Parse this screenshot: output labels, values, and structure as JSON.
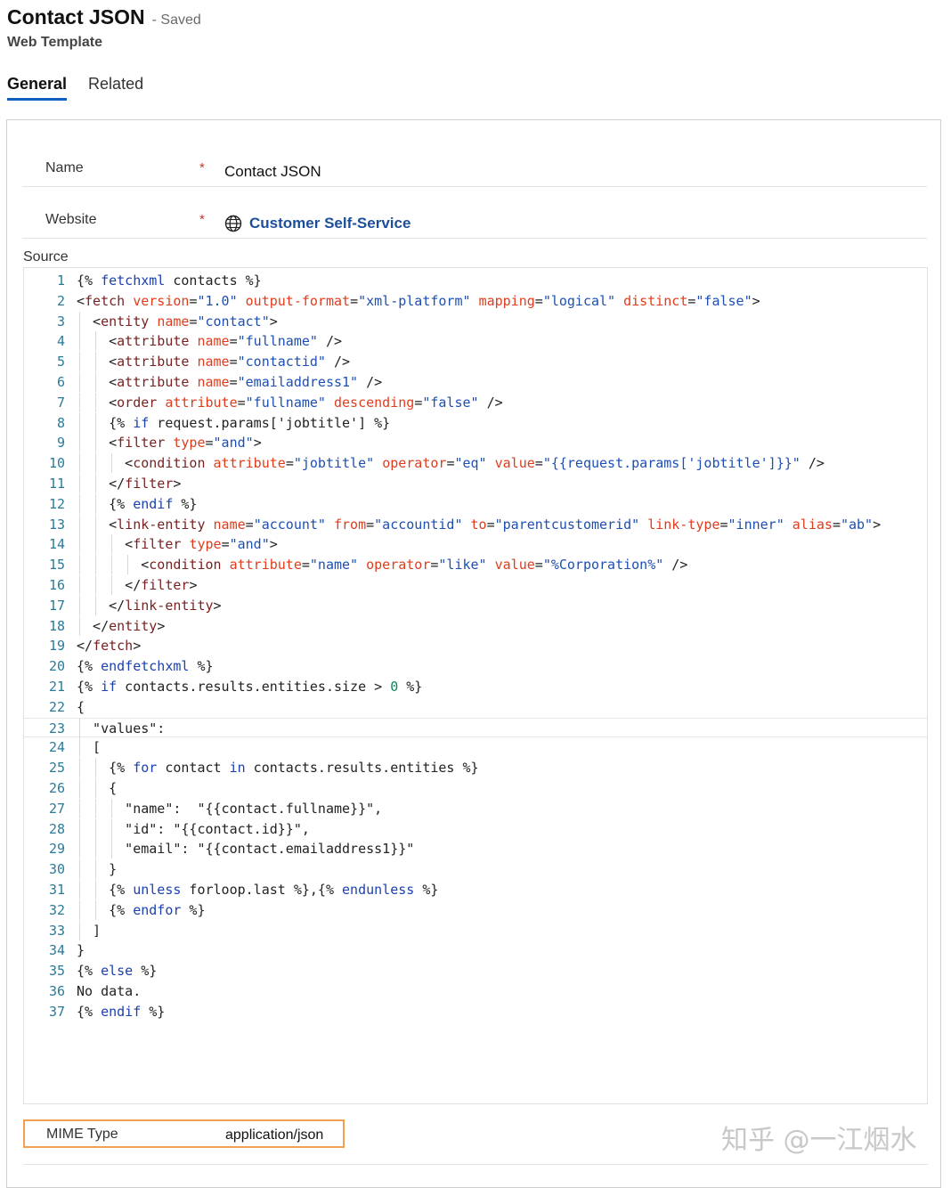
{
  "header": {
    "title": "Contact JSON",
    "status": "- Saved",
    "subtitle": "Web Template"
  },
  "tabs": [
    {
      "label": "General",
      "active": true
    },
    {
      "label": "Related",
      "active": false
    }
  ],
  "fields": {
    "name": {
      "label": "Name",
      "required": "*",
      "value": "Contact JSON"
    },
    "website": {
      "label": "Website",
      "required": "*",
      "value": "Customer Self-Service",
      "icon": "globe-icon"
    },
    "source": {
      "label": "Source"
    },
    "mime": {
      "label": "MIME Type",
      "value": "application/json"
    }
  },
  "code_lines": [
    "{% fetchxml contacts %}",
    "<fetch version=\"1.0\" output-format=\"xml-platform\" mapping=\"logical\" distinct=\"false\">",
    "  <entity name=\"contact\">",
    "    <attribute name=\"fullname\" />",
    "    <attribute name=\"contactid\" />",
    "    <attribute name=\"emailaddress1\" />",
    "    <order attribute=\"fullname\" descending=\"false\" />",
    "    {% if request.params['jobtitle'] %}",
    "    <filter type=\"and\">",
    "      <condition attribute=\"jobtitle\" operator=\"eq\" value=\"{{request.params['jobtitle']}}\" />",
    "    </filter>",
    "    {% endif %}",
    "    <link-entity name=\"account\" from=\"accountid\" to=\"parentcustomerid\" link-type=\"inner\" alias=\"ab\">",
    "      <filter type=\"and\">",
    "        <condition attribute=\"name\" operator=\"like\" value=\"%Corporation%\" />",
    "      </filter>",
    "    </link-entity>",
    "  </entity>",
    "</fetch>",
    "{% endfetchxml %}",
    "{% if contacts.results.entities.size > 0 %}",
    "{",
    "  \"values\":",
    "  [",
    "    {% for contact in contacts.results.entities %}",
    "    {",
    "      \"name\":  \"{{contact.fullname}}\",",
    "      \"id\": \"{{contact.id}}\",",
    "      \"email\": \"{{contact.emailaddress1}}\"",
    "    }",
    "    {% unless forloop.last %},{% endunless %}",
    "    {% endfor %}",
    "  ]",
    "}",
    "{% else %}",
    "No data.",
    "{% endif %}"
  ],
  "watermark": "知乎 @一江烟水",
  "colors": {
    "accent": "#1060c0",
    "link": "#1b4f9c",
    "required": "#c0392b",
    "highlight_border": "#f0a050"
  }
}
